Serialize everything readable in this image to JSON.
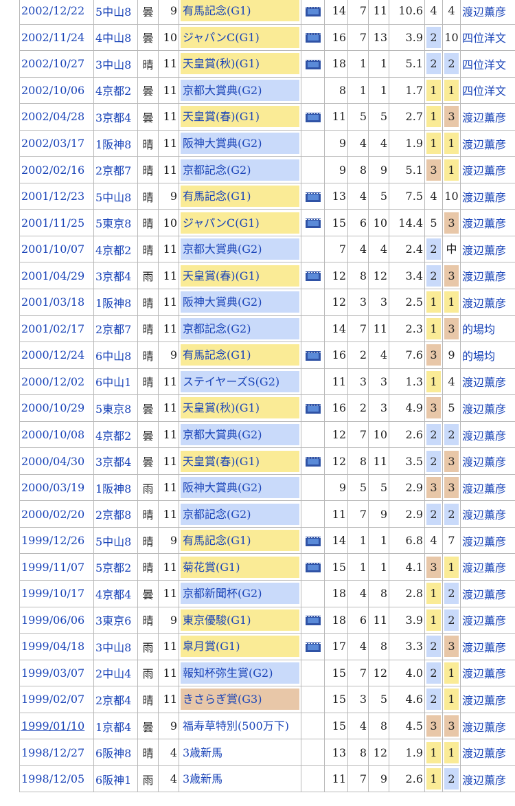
{
  "colors": {
    "link": "#1a44b8",
    "race_g1": "#faeb96",
    "race_g2": "#c9dafa",
    "race_g3": "#e8c7a8",
    "rank_1": "#faeb96",
    "rank_2": "#c9dafa",
    "rank_3": "#e8c7a8"
  },
  "rows": [
    {
      "date": "2002/12/22",
      "venue": "5中山8",
      "weather": "曇",
      "heads": "9",
      "race": "有馬記念(G1)",
      "grade": "g1",
      "video": true,
      "field": "14",
      "gate": "7",
      "horse_no": "11",
      "odds": "10.6",
      "pop": "4",
      "finish": "4",
      "jockey": "渡辺薫彦"
    },
    {
      "date": "2002/11/24",
      "venue": "4中山8",
      "weather": "曇",
      "heads": "10",
      "race": "ジャパンC(G1)",
      "grade": "g1",
      "video": true,
      "field": "16",
      "gate": "7",
      "horse_no": "13",
      "odds": "3.9",
      "pop": "2",
      "finish": "10",
      "jockey": "四位洋文"
    },
    {
      "date": "2002/10/27",
      "venue": "3中山8",
      "weather": "晴",
      "heads": "11",
      "race": "天皇賞(秋)(G1)",
      "grade": "g1",
      "video": true,
      "field": "18",
      "gate": "1",
      "horse_no": "1",
      "odds": "5.1",
      "pop": "2",
      "finish": "2",
      "jockey": "四位洋文"
    },
    {
      "date": "2002/10/06",
      "venue": "4京都2",
      "weather": "曇",
      "heads": "11",
      "race": "京都大賞典(G2)",
      "grade": "g2",
      "video": false,
      "field": "8",
      "gate": "1",
      "horse_no": "1",
      "odds": "1.7",
      "pop": "1",
      "finish": "1",
      "jockey": "四位洋文"
    },
    {
      "date": "2002/04/28",
      "venue": "3京都4",
      "weather": "曇",
      "heads": "11",
      "race": "天皇賞(春)(G1)",
      "grade": "g1",
      "video": true,
      "field": "11",
      "gate": "5",
      "horse_no": "5",
      "odds": "2.7",
      "pop": "1",
      "finish": "3",
      "jockey": "渡辺薫彦"
    },
    {
      "date": "2002/03/17",
      "venue": "1阪神8",
      "weather": "晴",
      "heads": "11",
      "race": "阪神大賞典(G2)",
      "grade": "g2",
      "video": false,
      "field": "9",
      "gate": "4",
      "horse_no": "4",
      "odds": "1.9",
      "pop": "1",
      "finish": "1",
      "jockey": "渡辺薫彦"
    },
    {
      "date": "2002/02/16",
      "venue": "2京都7",
      "weather": "晴",
      "heads": "11",
      "race": "京都記念(G2)",
      "grade": "g2",
      "video": false,
      "field": "9",
      "gate": "8",
      "horse_no": "9",
      "odds": "5.1",
      "pop": "3",
      "finish": "1",
      "jockey": "渡辺薫彦"
    },
    {
      "date": "2001/12/23",
      "venue": "5中山8",
      "weather": "晴",
      "heads": "9",
      "race": "有馬記念(G1)",
      "grade": "g1",
      "video": true,
      "field": "13",
      "gate": "4",
      "horse_no": "5",
      "odds": "7.5",
      "pop": "4",
      "finish": "10",
      "jockey": "渡辺薫彦"
    },
    {
      "date": "2001/11/25",
      "venue": "5東京8",
      "weather": "晴",
      "heads": "10",
      "race": "ジャパンC(G1)",
      "grade": "g1",
      "video": true,
      "field": "15",
      "gate": "6",
      "horse_no": "10",
      "odds": "14.4",
      "pop": "5",
      "finish": "3",
      "jockey": "渡辺薫彦"
    },
    {
      "date": "2001/10/07",
      "venue": "4京都2",
      "weather": "晴",
      "heads": "11",
      "race": "京都大賞典(G2)",
      "grade": "g2",
      "video": false,
      "field": "7",
      "gate": "4",
      "horse_no": "4",
      "odds": "2.4",
      "pop": "2",
      "finish": "中",
      "jockey": "渡辺薫彦"
    },
    {
      "date": "2001/04/29",
      "venue": "3京都4",
      "weather": "雨",
      "heads": "11",
      "race": "天皇賞(春)(G1)",
      "grade": "g1",
      "video": true,
      "field": "12",
      "gate": "8",
      "horse_no": "12",
      "odds": "3.4",
      "pop": "2",
      "finish": "3",
      "jockey": "渡辺薫彦"
    },
    {
      "date": "2001/03/18",
      "venue": "1阪神8",
      "weather": "晴",
      "heads": "11",
      "race": "阪神大賞典(G2)",
      "grade": "g2",
      "video": false,
      "field": "12",
      "gate": "3",
      "horse_no": "3",
      "odds": "2.5",
      "pop": "1",
      "finish": "1",
      "jockey": "渡辺薫彦"
    },
    {
      "date": "2001/02/17",
      "venue": "2京都7",
      "weather": "晴",
      "heads": "11",
      "race": "京都記念(G2)",
      "grade": "g2",
      "video": false,
      "field": "14",
      "gate": "7",
      "horse_no": "11",
      "odds": "2.3",
      "pop": "1",
      "finish": "3",
      "jockey": "的場均"
    },
    {
      "date": "2000/12/24",
      "venue": "6中山8",
      "weather": "晴",
      "heads": "9",
      "race": "有馬記念(G1)",
      "grade": "g1",
      "video": true,
      "field": "16",
      "gate": "2",
      "horse_no": "4",
      "odds": "7.6",
      "pop": "3",
      "finish": "9",
      "jockey": "的場均"
    },
    {
      "date": "2000/12/02",
      "venue": "6中山1",
      "weather": "晴",
      "heads": "11",
      "race": "ステイヤーズS(G2)",
      "grade": "g2",
      "video": false,
      "field": "11",
      "gate": "3",
      "horse_no": "3",
      "odds": "1.3",
      "pop": "1",
      "finish": "4",
      "jockey": "渡辺薫彦"
    },
    {
      "date": "2000/10/29",
      "venue": "5東京8",
      "weather": "曇",
      "heads": "11",
      "race": "天皇賞(秋)(G1)",
      "grade": "g1",
      "video": true,
      "field": "16",
      "gate": "2",
      "horse_no": "3",
      "odds": "4.9",
      "pop": "3",
      "finish": "5",
      "jockey": "渡辺薫彦"
    },
    {
      "date": "2000/10/08",
      "venue": "4京都2",
      "weather": "曇",
      "heads": "11",
      "race": "京都大賞典(G2)",
      "grade": "g2",
      "video": false,
      "field": "12",
      "gate": "7",
      "horse_no": "10",
      "odds": "2.6",
      "pop": "2",
      "finish": "2",
      "jockey": "渡辺薫彦"
    },
    {
      "date": "2000/04/30",
      "venue": "3京都4",
      "weather": "曇",
      "heads": "11",
      "race": "天皇賞(春)(G1)",
      "grade": "g1",
      "video": true,
      "field": "12",
      "gate": "8",
      "horse_no": "11",
      "odds": "3.5",
      "pop": "2",
      "finish": "3",
      "jockey": "渡辺薫彦"
    },
    {
      "date": "2000/03/19",
      "venue": "1阪神8",
      "weather": "雨",
      "heads": "11",
      "race": "阪神大賞典(G2)",
      "grade": "g2",
      "video": false,
      "field": "9",
      "gate": "5",
      "horse_no": "5",
      "odds": "2.9",
      "pop": "3",
      "finish": "3",
      "jockey": "渡辺薫彦"
    },
    {
      "date": "2000/02/20",
      "venue": "2京都8",
      "weather": "晴",
      "heads": "11",
      "race": "京都記念(G2)",
      "grade": "g2",
      "video": false,
      "field": "11",
      "gate": "7",
      "horse_no": "9",
      "odds": "2.9",
      "pop": "2",
      "finish": "2",
      "jockey": "渡辺薫彦"
    },
    {
      "date": "1999/12/26",
      "venue": "5中山8",
      "weather": "晴",
      "heads": "9",
      "race": "有馬記念(G1)",
      "grade": "g1",
      "video": true,
      "field": "14",
      "gate": "1",
      "horse_no": "1",
      "odds": "6.8",
      "pop": "4",
      "finish": "7",
      "jockey": "渡辺薫彦"
    },
    {
      "date": "1999/11/07",
      "venue": "5京都2",
      "weather": "晴",
      "heads": "11",
      "race": "菊花賞(G1)",
      "grade": "g1",
      "video": true,
      "field": "15",
      "gate": "1",
      "horse_no": "1",
      "odds": "4.1",
      "pop": "3",
      "finish": "1",
      "jockey": "渡辺薫彦"
    },
    {
      "date": "1999/10/17",
      "venue": "4京都4",
      "weather": "曇",
      "heads": "11",
      "race": "京都新聞杯(G2)",
      "grade": "g2",
      "video": false,
      "field": "18",
      "gate": "4",
      "horse_no": "8",
      "odds": "2.8",
      "pop": "1",
      "finish": "2",
      "jockey": "渡辺薫彦"
    },
    {
      "date": "1999/06/06",
      "venue": "3東京6",
      "weather": "晴",
      "heads": "9",
      "race": "東京優駿(G1)",
      "grade": "g1",
      "video": true,
      "field": "18",
      "gate": "6",
      "horse_no": "11",
      "odds": "3.9",
      "pop": "1",
      "finish": "2",
      "jockey": "渡辺薫彦"
    },
    {
      "date": "1999/04/18",
      "venue": "3中山8",
      "weather": "雨",
      "heads": "11",
      "race": "皐月賞(G1)",
      "grade": "g1",
      "video": true,
      "field": "17",
      "gate": "4",
      "horse_no": "8",
      "odds": "3.3",
      "pop": "2",
      "finish": "3",
      "jockey": "渡辺薫彦"
    },
    {
      "date": "1999/03/07",
      "venue": "2中山4",
      "weather": "雨",
      "heads": "11",
      "race": "報知杯弥生賞(G2)",
      "grade": "g2",
      "video": false,
      "field": "15",
      "gate": "7",
      "horse_no": "12",
      "odds": "4.0",
      "pop": "2",
      "finish": "1",
      "jockey": "渡辺薫彦"
    },
    {
      "date": "1999/02/07",
      "venue": "2京都4",
      "weather": "晴",
      "heads": "11",
      "race": "きさらぎ賞(G3)",
      "grade": "g3",
      "video": false,
      "field": "15",
      "gate": "3",
      "horse_no": "5",
      "odds": "4.6",
      "pop": "2",
      "finish": "1",
      "jockey": "渡辺薫彦"
    },
    {
      "date": "1999/01/10",
      "venue": "1京都4",
      "weather": "曇",
      "heads": "9",
      "race": "福寿草特別(500万下)",
      "grade": "",
      "video": false,
      "field": "15",
      "gate": "4",
      "horse_no": "8",
      "odds": "4.5",
      "pop": "3",
      "finish": "3",
      "jockey": "渡辺薫彦",
      "date_underline": true
    },
    {
      "date": "1998/12/27",
      "venue": "6阪神8",
      "weather": "晴",
      "heads": "4",
      "race": "3歳新馬",
      "grade": "",
      "video": false,
      "field": "13",
      "gate": "8",
      "horse_no": "12",
      "odds": "1.9",
      "pop": "1",
      "finish": "1",
      "jockey": "渡辺薫彦"
    },
    {
      "date": "1998/12/05",
      "venue": "6阪神1",
      "weather": "雨",
      "heads": "4",
      "race": "3歳新馬",
      "grade": "",
      "video": false,
      "field": "11",
      "gate": "7",
      "horse_no": "9",
      "odds": "2.6",
      "pop": "1",
      "finish": "2",
      "jockey": "渡辺薫彦"
    }
  ]
}
